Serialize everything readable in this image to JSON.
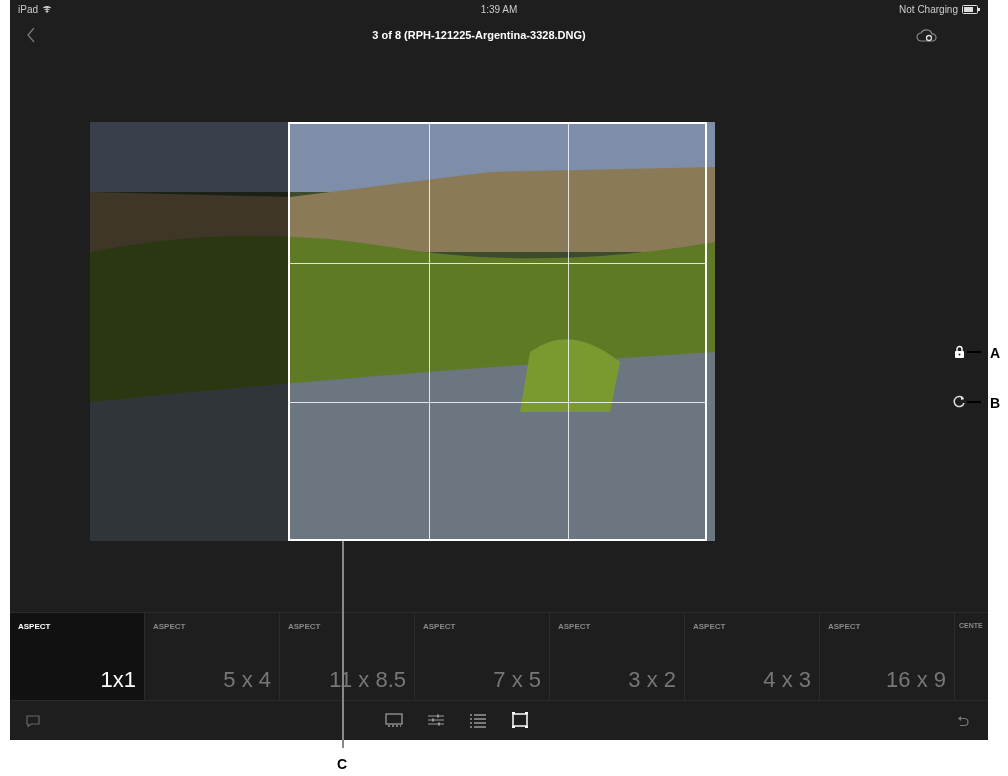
{
  "status_bar": {
    "device": "iPad",
    "time": "1:39 AM",
    "battery_text": "Not Charging"
  },
  "header": {
    "title": "3 of 8 (RPH-121225-Argentina-3328.DNG)"
  },
  "aspect_presets": [
    {
      "label": "ASPECT",
      "value": "1x1",
      "selected": true
    },
    {
      "label": "ASPECT",
      "value": "5 x 4",
      "selected": false
    },
    {
      "label": "ASPECT",
      "value": "11 x 8.5",
      "selected": false
    },
    {
      "label": "ASPECT",
      "value": "7 x 5",
      "selected": false
    },
    {
      "label": "ASPECT",
      "value": "3 x 2",
      "selected": false
    },
    {
      "label": "ASPECT",
      "value": "4 x 3",
      "selected": false
    },
    {
      "label": "ASPECT",
      "value": "16 x 9",
      "selected": false
    },
    {
      "label": "CENTE",
      "selected": false
    }
  ],
  "toolbar_tools": [
    {
      "kind": "filmstrip",
      "selected": false
    },
    {
      "kind": "sliders",
      "selected": false
    },
    {
      "kind": "list",
      "selected": false
    },
    {
      "kind": "crop",
      "selected": true
    }
  ],
  "callouts": [
    {
      "letter": "A"
    },
    {
      "letter": "B"
    },
    {
      "letter": "C"
    }
  ]
}
